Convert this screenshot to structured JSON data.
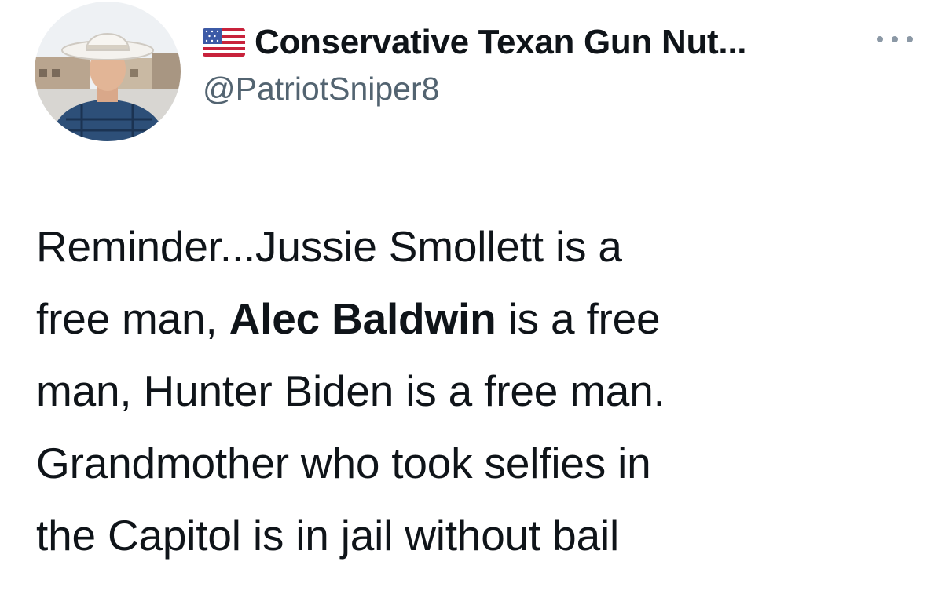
{
  "author": {
    "display_name": "Conservative Texan Gun Nut...",
    "handle": "@PatriotSniper8",
    "flag_icon": "us-flag-icon",
    "avatar_icon": "profile-photo-cowboy-hat"
  },
  "menu": {
    "icon": "more-options-icon"
  },
  "tweet": {
    "line1": "Reminder...Jussie Smollett is a",
    "line2_start": "free man, ",
    "line2_bold": "Alec Baldwin",
    "line2_end": " is a free",
    "line3": "man, Hunter Biden is a free man.",
    "line4": "Grandmother who took selfies in",
    "line5": "the Capitol is in jail without bail"
  },
  "colors": {
    "text": "#0f1419",
    "secondary": "#536471",
    "background": "#ffffff"
  }
}
